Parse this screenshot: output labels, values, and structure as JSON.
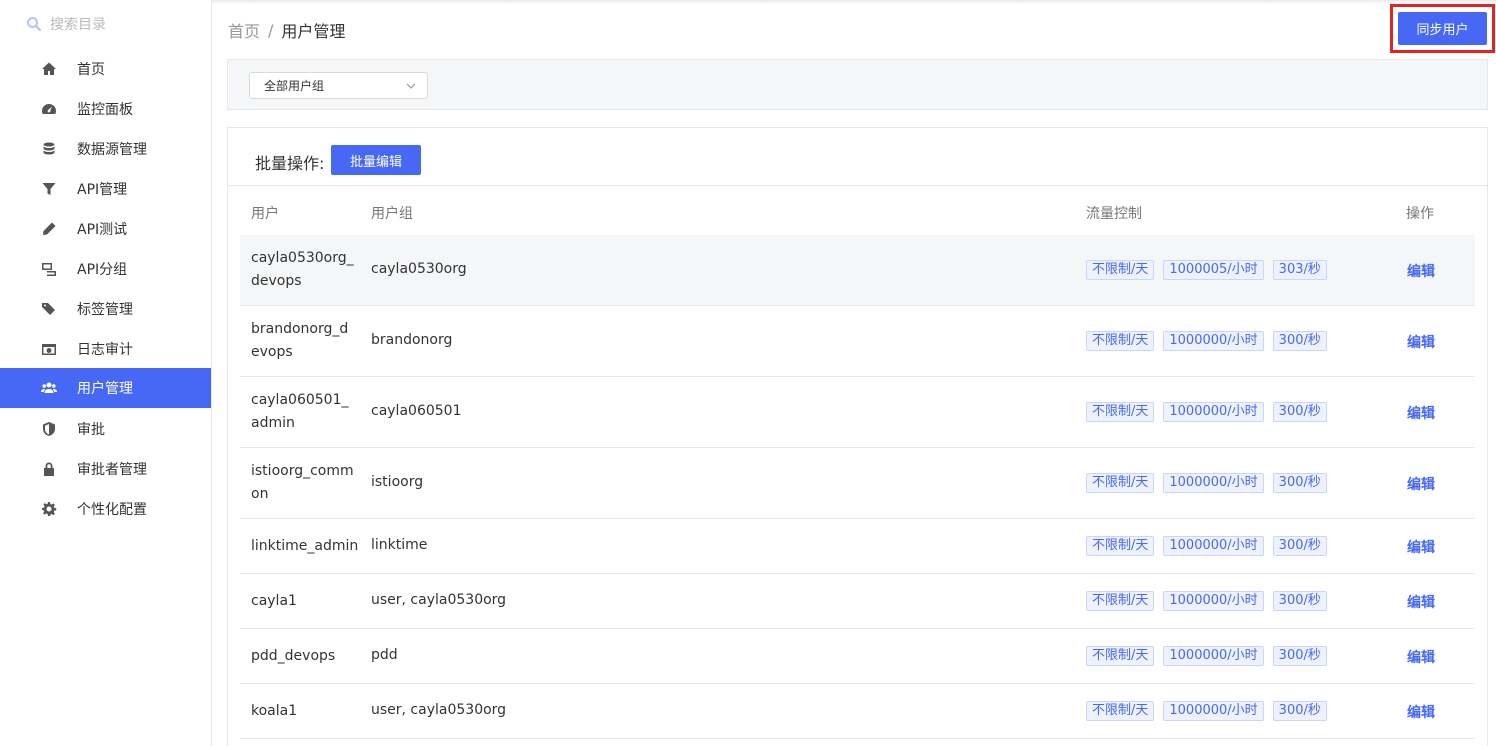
{
  "sidebar": {
    "search_placeholder": "搜索目录",
    "items": [
      {
        "label": "首页",
        "icon": "home-icon"
      },
      {
        "label": "监控面板",
        "icon": "dashboard-icon"
      },
      {
        "label": "数据源管理",
        "icon": "database-icon"
      },
      {
        "label": "API管理",
        "icon": "filter-icon"
      },
      {
        "label": "API测试",
        "icon": "pencil-icon"
      },
      {
        "label": "API分组",
        "icon": "group-icon"
      },
      {
        "label": "标签管理",
        "icon": "tags-icon"
      },
      {
        "label": "日志审计",
        "icon": "camera-icon"
      },
      {
        "label": "用户管理",
        "icon": "users-icon",
        "active": true
      },
      {
        "label": "审批",
        "icon": "shield-icon"
      },
      {
        "label": "审批者管理",
        "icon": "lock-icon"
      },
      {
        "label": "个性化配置",
        "icon": "gear-icon"
      }
    ]
  },
  "breadcrumb": {
    "home": "首页",
    "sep": "/",
    "current": "用户管理"
  },
  "header": {
    "sync_button": "同步用户"
  },
  "filter": {
    "group_select": "全部用户组"
  },
  "batch": {
    "label": "批量操作:",
    "edit_button": "批量编辑"
  },
  "table": {
    "columns": {
      "user": "用户",
      "group": "用户组",
      "traffic": "流量控制",
      "action": "操作"
    },
    "rows": [
      {
        "user": "cayla0530org_devops",
        "group": "cayla0530org",
        "tags": [
          "不限制/天",
          "1000005/小时",
          "303/秒"
        ],
        "action": "编辑"
      },
      {
        "user": "brandonorg_devops",
        "group": "brandonorg",
        "tags": [
          "不限制/天",
          "1000000/小时",
          "300/秒"
        ],
        "action": "编辑"
      },
      {
        "user": "cayla060501_admin",
        "group": "cayla060501",
        "tags": [
          "不限制/天",
          "1000000/小时",
          "300/秒"
        ],
        "action": "编辑"
      },
      {
        "user": "istioorg_common",
        "group": "istioorg",
        "tags": [
          "不限制/天",
          "1000000/小时",
          "300/秒"
        ],
        "action": "编辑"
      },
      {
        "user": "linktime_admin",
        "group": "linktime",
        "tags": [
          "不限制/天",
          "1000000/小时",
          "300/秒"
        ],
        "action": "编辑"
      },
      {
        "user": "cayla1",
        "group": "user, cayla0530org",
        "tags": [
          "不限制/天",
          "1000000/小时",
          "300/秒"
        ],
        "action": "编辑"
      },
      {
        "user": "pdd_devops",
        "group": "pdd",
        "tags": [
          "不限制/天",
          "1000000/小时",
          "300/秒"
        ],
        "action": "编辑"
      },
      {
        "user": "koala1",
        "group": "user, cayla0530org",
        "tags": [
          "不限制/天",
          "1000000/小时",
          "300/秒"
        ],
        "action": "编辑"
      }
    ]
  },
  "colors": {
    "primary": "#4668f5",
    "highlight": "#e02424"
  }
}
